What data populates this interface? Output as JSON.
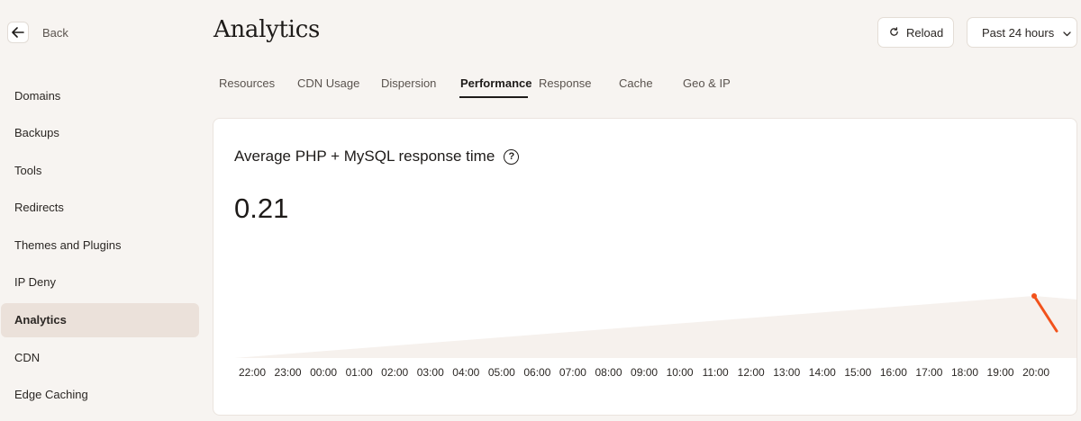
{
  "sidebar": {
    "back_label": "Back",
    "items": [
      {
        "label": "Domains"
      },
      {
        "label": "Backups"
      },
      {
        "label": "Tools"
      },
      {
        "label": "Redirects"
      },
      {
        "label": "Themes and Plugins"
      },
      {
        "label": "IP Deny"
      },
      {
        "label": "Analytics",
        "active": true
      },
      {
        "label": "CDN"
      },
      {
        "label": "Edge Caching"
      }
    ]
  },
  "header": {
    "title": "Analytics",
    "reload_label": "Reload",
    "range_label": "Past 24 hours"
  },
  "tabs": [
    {
      "label": "Resources"
    },
    {
      "label": "CDN Usage"
    },
    {
      "label": "Dispersion"
    },
    {
      "label": "Performance",
      "active": true
    },
    {
      "label": "Response"
    },
    {
      "label": "Cache"
    },
    {
      "label": "Geo & IP"
    }
  ],
  "card": {
    "title": "Average PHP + MySQL response time",
    "value": "0.21"
  },
  "colors": {
    "accent": "#f2521b",
    "area": "#f6f1ed",
    "active_bg": "#ebe1da"
  },
  "chart_data": {
    "type": "area",
    "x": [
      "22:00",
      "23:00",
      "00:00",
      "01:00",
      "02:00",
      "03:00",
      "04:00",
      "05:00",
      "06:00",
      "07:00",
      "08:00",
      "09:00",
      "10:00",
      "11:00",
      "12:00",
      "13:00",
      "14:00",
      "15:00",
      "16:00",
      "17:00",
      "18:00",
      "19:00",
      "20:00"
    ],
    "y": [
      0.0,
      0.21
    ],
    "title": "Average PHP + MySQL response time",
    "xlabel": "",
    "ylabel": "",
    "grid": false
  }
}
